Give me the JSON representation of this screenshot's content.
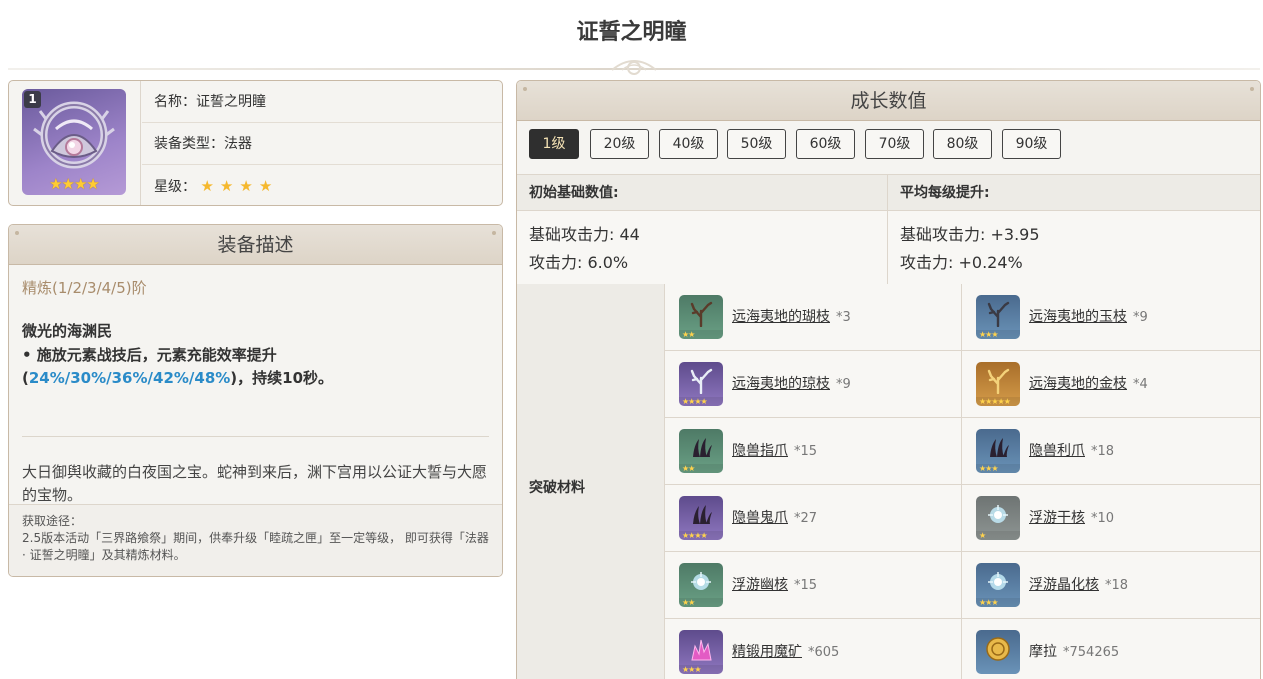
{
  "page": {
    "title": "证誓之明瞳"
  },
  "info": {
    "refine_badge": "1",
    "name_label": "名称：",
    "name_value": "证誓之明瞳",
    "type_label": "装备类型：",
    "type_value": "法器",
    "rarity_label": "星级：",
    "rarity_stars": 4,
    "star_glyph": "★",
    "portrait_stars": "★★★★"
  },
  "description": {
    "header": "装备描述",
    "refine_levels": "精炼(1/2/3/4/5)阶",
    "passive_name": "微光的海渊民",
    "passive_text_pre": "• 施放元素战技后，元素充能效率提升(",
    "passive_values": "24%/30%/36%/42%/48%",
    "passive_text_post": ")，持续10秒。",
    "lore": "大日御舆收藏的白夜国之宝。蛇神到来后，渊下宫用以公证大誓与大愿的宝物。",
    "source_label": "获取途径：",
    "source_text": "2.5版本活动「三界路飨祭」期间，供奉升级「睦疏之匣」至一定等级， 即可获得「法器 · 证誓之明瞳」及其精炼材料。"
  },
  "growth": {
    "header": "成长数值",
    "level_tabs": [
      "1级",
      "20级",
      "40级",
      "50级",
      "60级",
      "70级",
      "80级",
      "90级"
    ],
    "active_tab": 0,
    "base_header": "初始基础数值:",
    "avg_header": "平均每级提升:",
    "base_atk": "基础攻击力: 44",
    "base_sub": "攻击力: 6.0%",
    "avg_atk": "基础攻击力: +3.95",
    "avg_sub": "攻击力: +0.24%",
    "materials_label": "突破材料",
    "materials": [
      {
        "name": "远海夷地的瑚枝",
        "count": "*3",
        "bg": "green",
        "stars": "★★",
        "icon": "coral-branch-icon"
      },
      {
        "name": "远海夷地的玉枝",
        "count": "*9",
        "bg": "blue",
        "stars": "★★★",
        "icon": "jade-branch-icon"
      },
      {
        "name": "远海夷地的琼枝",
        "count": "*9",
        "bg": "purple",
        "stars": "★★★★",
        "icon": "jeweled-branch-icon"
      },
      {
        "name": "远海夷地的金枝",
        "count": "*4",
        "bg": "gold",
        "stars": "★★★★★",
        "icon": "golden-branch-icon"
      },
      {
        "name": "隐兽指爪",
        "count": "*15",
        "bg": "green",
        "stars": "★★",
        "icon": "claw-icon"
      },
      {
        "name": "隐兽利爪",
        "count": "*18",
        "bg": "blue",
        "stars": "★★★",
        "icon": "sharp-claw-icon"
      },
      {
        "name": "隐兽鬼爪",
        "count": "*27",
        "bg": "purple",
        "stars": "★★★★",
        "icon": "ghost-claw-icon"
      },
      {
        "name": "浮游干核",
        "count": "*10",
        "bg": "gray",
        "stars": "★",
        "icon": "dry-core-icon"
      },
      {
        "name": "浮游幽核",
        "count": "*15",
        "bg": "green",
        "stars": "★★",
        "icon": "hollow-core-icon"
      },
      {
        "name": "浮游晶化核",
        "count": "*18",
        "bg": "blue",
        "stars": "★★★",
        "icon": "crystal-core-icon"
      },
      {
        "name": "精锻用魔矿",
        "count": "*605",
        "bg": "purple",
        "stars": "★★★",
        "icon": "magic-ore-icon"
      },
      {
        "name": "摩拉",
        "count": "*754265",
        "bg": "blue",
        "stars": "",
        "icon": "mora-coin-icon",
        "plain": true
      }
    ]
  },
  "colors": {
    "accent_blue": "#2a8bc8",
    "refine_gold": "#a88c6c",
    "active_tab_bg": "#2f2f2f"
  }
}
